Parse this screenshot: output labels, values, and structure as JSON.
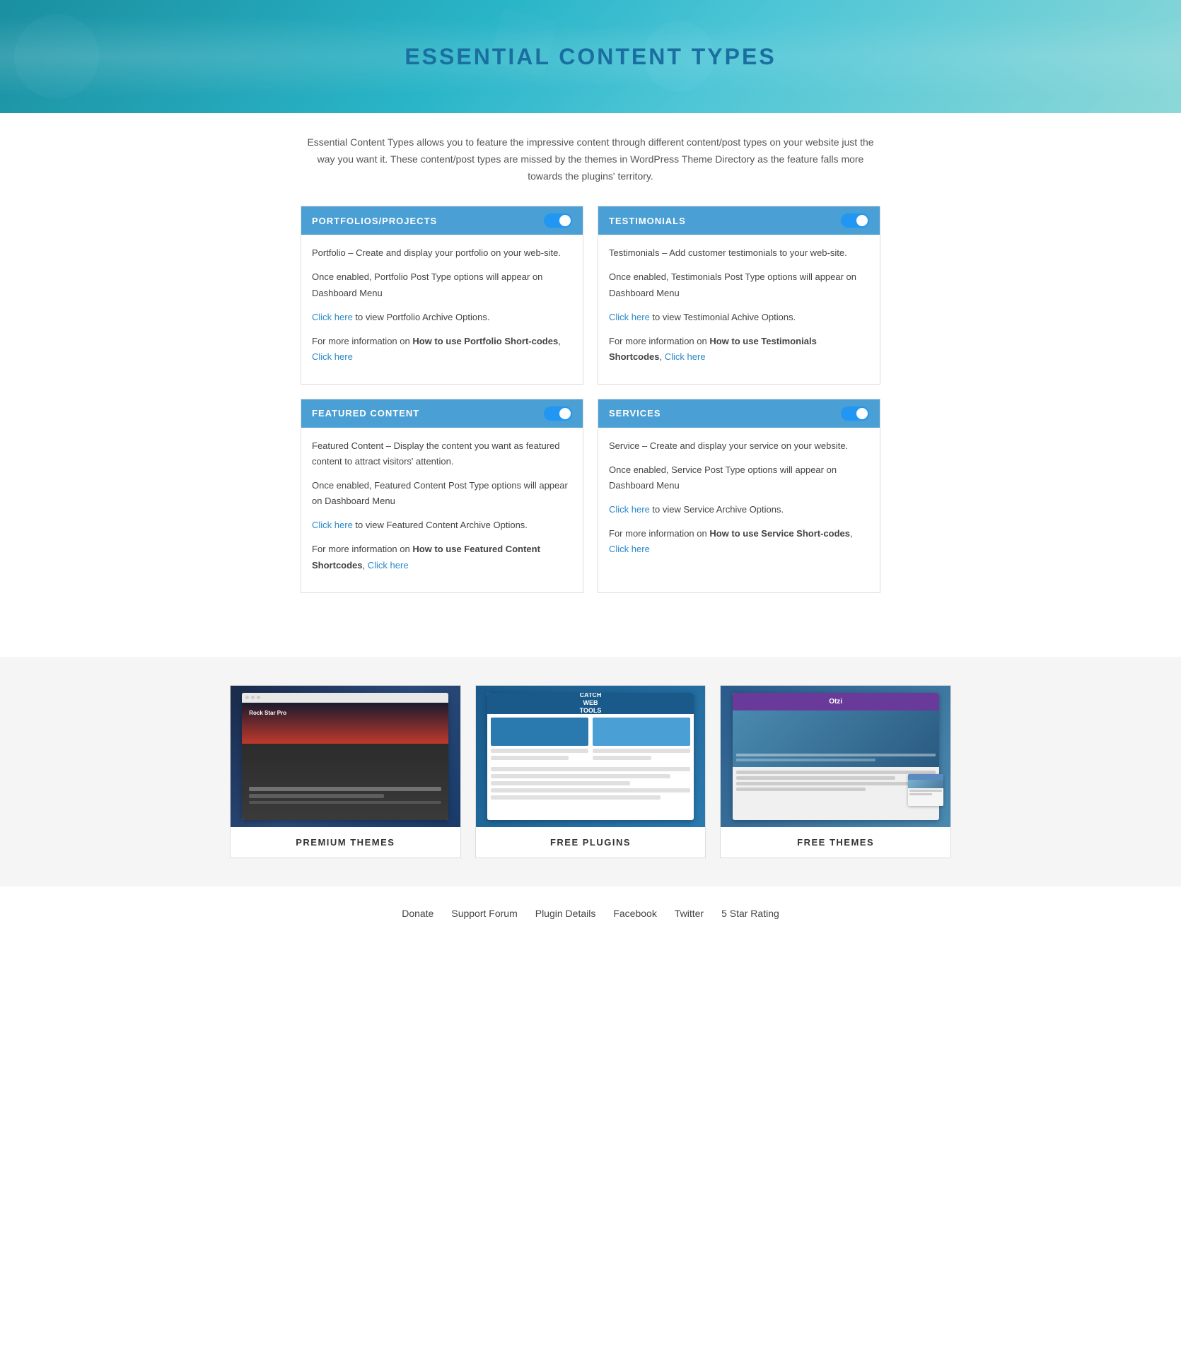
{
  "hero": {
    "title": "ESSENTIAL CONTENT TYPES"
  },
  "description": "Essential Content Types allows you to feature the impressive content through different content/post types on your website just the way you want it. These content/post types are missed by the themes in WordPress Theme Directory as the feature falls more towards the plugins' territory.",
  "cards": [
    {
      "id": "portfolios",
      "header": "PORTFOLIOS/PROJECTS",
      "toggle": "on",
      "body_line1": "Portfolio – Create and display your portfolio on your web-site.",
      "body_line2": "Once enabled, Portfolio Post Type options will appear on Dashboard Menu",
      "link1_text": "Click here",
      "link1_suffix": " to view Portfolio Archive Options.",
      "body_line3": "For more information on ",
      "bold_text": "How to use Portfolio Short-codes",
      "link2_text": "Click here",
      "link2_prefix": ", "
    },
    {
      "id": "testimonials",
      "header": "TESTIMONIALS",
      "toggle": "on",
      "body_line1": "Testimonials – Add customer testimonials to your web-site.",
      "body_line2": "Once enabled, Testimonials Post Type options will appear on Dashboard Menu",
      "link1_text": "Click here",
      "link1_suffix": " to view Testimonial Achive Options.",
      "body_line3": "For more information on ",
      "bold_text": "How to use Testimonials Shortcodes",
      "link2_text": "Click here",
      "link2_prefix": ", "
    },
    {
      "id": "featured",
      "header": "FEATURED CONTENT",
      "toggle": "on",
      "body_line1": "Featured Content – Display the content you want as featured content to attract visitors' attention.",
      "body_line2": "Once enabled, Featured Content Post Type options will appear on Dashboard Menu",
      "link1_text": "Click here",
      "link1_suffix": " to view Featured Content Archive Options.",
      "body_line3": "For more information on ",
      "bold_text": "How to use Featured Content Shortcodes",
      "link2_text": "Click here",
      "link2_prefix": ", "
    },
    {
      "id": "services",
      "header": "SERVICES",
      "toggle": "on",
      "body_line1": "Service – Create and display your service on your website.",
      "body_line2": "Once enabled, Service Post Type options will appear on Dashboard Menu",
      "link1_text": "Click here",
      "link1_suffix": " to view Service Archive Options.",
      "body_line3": "For more information on ",
      "bold_text": "How to use Service Short-codes",
      "link2_text": "Click here",
      "link2_prefix": ", "
    }
  ],
  "promo": [
    {
      "id": "premium-themes",
      "label": "PREMIUM THEMES"
    },
    {
      "id": "free-plugins",
      "label": "FREE PLUGINS"
    },
    {
      "id": "free-themes",
      "label": "FREE THEMES"
    }
  ],
  "footer": {
    "links": [
      {
        "label": "Donate",
        "href": "#"
      },
      {
        "label": "Support Forum",
        "href": "#"
      },
      {
        "label": "Plugin Details",
        "href": "#"
      },
      {
        "label": "Facebook",
        "href": "#"
      },
      {
        "label": "Twitter",
        "href": "#"
      },
      {
        "label": "5 Star Rating",
        "href": "#"
      }
    ]
  }
}
